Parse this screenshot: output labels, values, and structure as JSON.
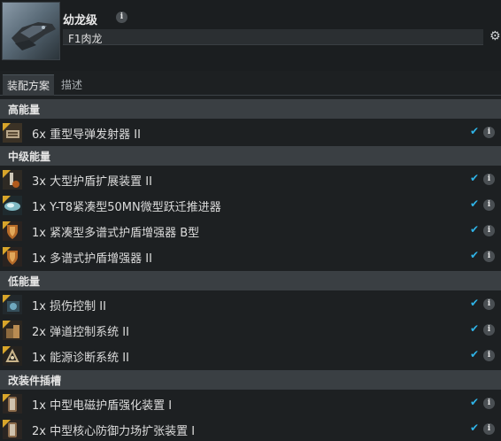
{
  "header": {
    "ship_name": "幼龙级",
    "fit_name": "F1肉龙",
    "info_glyph": "i",
    "settings_icon": "gear-icon",
    "ship_icon": "ship-render-icon"
  },
  "tabs": [
    {
      "label": "装配方案",
      "active": true
    },
    {
      "label": "描述",
      "active": false
    }
  ],
  "sections": [
    {
      "title": "高能量",
      "modules": [
        {
          "label": "6x 重型导弹发射器 II",
          "icon": "missile-launcher-icon"
        }
      ]
    },
    {
      "title": "中级能量",
      "modules": [
        {
          "label": "3x 大型护盾扩展装置 II",
          "icon": "shield-extender-icon"
        },
        {
          "label": "1x Y-T8紧凑型50MN微型跃迁推进器",
          "icon": "microwarpdrive-icon"
        },
        {
          "label": "1x 紧凑型多谱式护盾增强器 B型",
          "icon": "shield-hardener-icon"
        },
        {
          "label": "1x 多谱式护盾增强器 II",
          "icon": "shield-hardener-icon"
        }
      ]
    },
    {
      "title": "低能量",
      "modules": [
        {
          "label": "1x 损伤控制 II",
          "icon": "damage-control-icon"
        },
        {
          "label": "2x 弹道控制系统 II",
          "icon": "ballistic-control-icon"
        },
        {
          "label": "1x 能源诊断系统 II",
          "icon": "power-diagnostic-icon"
        }
      ]
    },
    {
      "title": "改装件插槽",
      "modules": [
        {
          "label": "1x 中型电磁护盾强化装置 I",
          "icon": "rig-icon"
        },
        {
          "label": "2x 中型核心防御力场扩张装置 I",
          "icon": "rig-icon"
        }
      ]
    }
  ],
  "row_check_glyph": "✔",
  "colors": {
    "background": "#1d2022",
    "section_bar": "#3a3f43",
    "check": "#2fb4e8"
  }
}
